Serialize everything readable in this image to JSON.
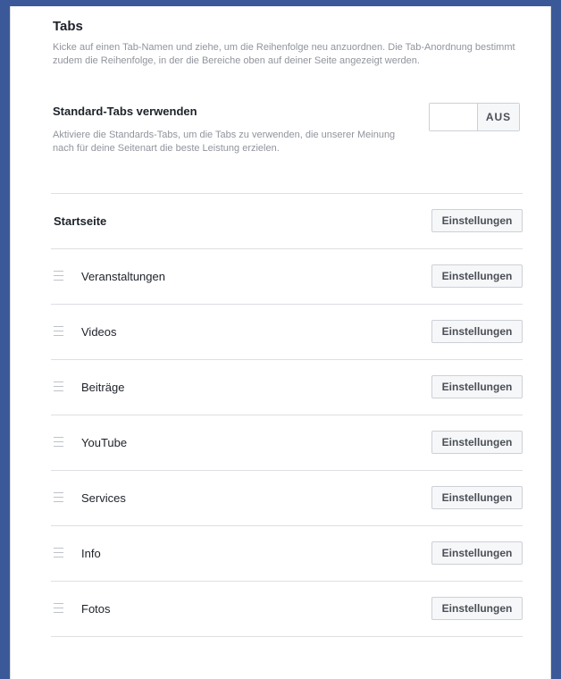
{
  "section": {
    "title": "Tabs",
    "description": "Kicke auf einen Tab-Namen und ziehe, um die Reihenfolge neu anzuordnen. Die Tab-Anordnung bestimmt zudem die Reihenfolge, in der die Bereiche oben auf deiner Seite angezeigt werden."
  },
  "standard_tabs": {
    "title": "Standard-Tabs verwenden",
    "description": "Aktiviere die Standards-Tabs, um die Tabs zu verwenden, die unserer Meinung nach für deine Seitenart die beste Leistung erzielen.",
    "toggle_label": "AUS",
    "toggle_state": "off"
  },
  "tabs": [
    {
      "label": "Startseite",
      "draggable": false,
      "button": "Einstellungen"
    },
    {
      "label": "Veranstaltungen",
      "draggable": true,
      "button": "Einstellungen"
    },
    {
      "label": "Videos",
      "draggable": true,
      "button": "Einstellungen"
    },
    {
      "label": "Beiträge",
      "draggable": true,
      "button": "Einstellungen"
    },
    {
      "label": "YouTube",
      "draggable": true,
      "button": "Einstellungen"
    },
    {
      "label": "Services",
      "draggable": true,
      "button": "Einstellungen"
    },
    {
      "label": "Info",
      "draggable": true,
      "button": "Einstellungen"
    },
    {
      "label": "Fotos",
      "draggable": true,
      "button": "Einstellungen"
    }
  ],
  "colors": {
    "frame": "#3b5998",
    "panel": "#ffffff",
    "text": "#1d2129",
    "muted": "#90949c",
    "border": "#dddfe2",
    "button_bg": "#f6f7f9"
  }
}
